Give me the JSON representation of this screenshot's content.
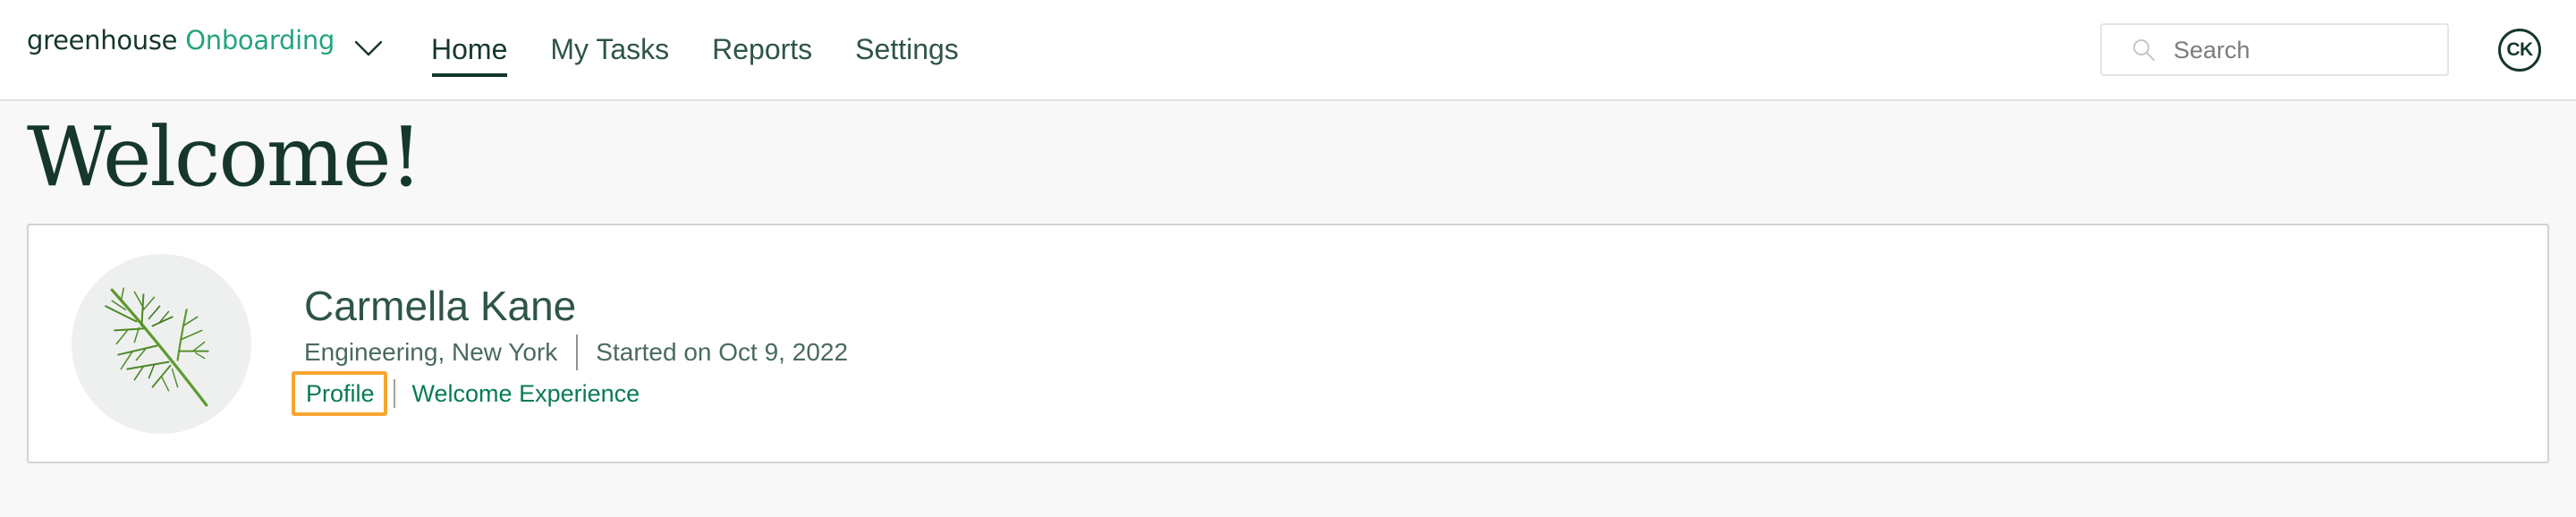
{
  "header": {
    "logo": {
      "brand": "greenhouse",
      "product": "Onboarding",
      "menu_icon": "chevron-down-icon"
    },
    "nav": [
      {
        "label": "Home",
        "active": true
      },
      {
        "label": "My Tasks",
        "active": false
      },
      {
        "label": "Reports",
        "active": false
      },
      {
        "label": "Settings",
        "active": false
      }
    ],
    "search": {
      "placeholder": "Search",
      "value": "",
      "icon": "search-icon"
    },
    "user_avatar": {
      "initials": "CK"
    }
  },
  "main": {
    "title": "Welcome!",
    "profile_card": {
      "avatar_image": "dill-sprig-illustration",
      "name": "Carmella Kane",
      "department_location": "Engineering, New York",
      "start_info": "Started on Oct 9, 2022",
      "links": [
        {
          "label": "Profile",
          "highlighted": true
        },
        {
          "label": "Welcome Experience",
          "highlighted": false
        }
      ]
    }
  },
  "colors": {
    "brand_dark": "#15372c",
    "brand_green": "#24a47f",
    "link_green": "#077a56",
    "highlight_orange": "#f7a531",
    "page_background": "#f7f8f7"
  }
}
